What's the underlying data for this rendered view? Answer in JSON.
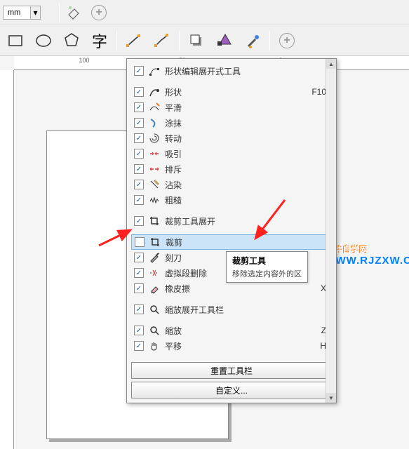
{
  "toolbar1": {
    "unit": "mm"
  },
  "ruler": {
    "labels": [
      "100",
      "50",
      "0"
    ]
  },
  "menu": {
    "groups": [
      {
        "items": [
          {
            "checked": true,
            "icon": "shape-edit",
            "label": "形状编辑展开式工具",
            "shortcut": ""
          }
        ]
      },
      {
        "items": [
          {
            "checked": true,
            "icon": "shape",
            "label": "形状",
            "shortcut": "F10"
          },
          {
            "checked": true,
            "icon": "smooth",
            "label": "平滑",
            "shortcut": ""
          },
          {
            "checked": true,
            "icon": "smear",
            "label": "涂抹",
            "shortcut": ""
          },
          {
            "checked": true,
            "icon": "twirl",
            "label": "转动",
            "shortcut": ""
          },
          {
            "checked": true,
            "icon": "attract",
            "label": "吸引",
            "shortcut": ""
          },
          {
            "checked": true,
            "icon": "repel",
            "label": "排斥",
            "shortcut": ""
          },
          {
            "checked": true,
            "icon": "stain",
            "label": "沾染",
            "shortcut": ""
          },
          {
            "checked": true,
            "icon": "roughen",
            "label": "粗糙",
            "shortcut": ""
          }
        ]
      },
      {
        "items": [
          {
            "checked": true,
            "icon": "crop-group",
            "label": "裁剪工具展开",
            "shortcut": ""
          }
        ]
      },
      {
        "items": [
          {
            "checked": false,
            "icon": "crop",
            "label": "裁剪",
            "shortcut": "",
            "highlighted": true
          },
          {
            "checked": true,
            "icon": "knife",
            "label": "刻刀",
            "shortcut": ""
          },
          {
            "checked": true,
            "icon": "vseg",
            "label": "虚拟段删除",
            "shortcut": ""
          },
          {
            "checked": true,
            "icon": "eraser",
            "label": "橡皮擦",
            "shortcut": "X"
          }
        ]
      },
      {
        "items": [
          {
            "checked": true,
            "icon": "zoom-group",
            "label": "缩放展开工具栏",
            "shortcut": ""
          }
        ]
      },
      {
        "items": [
          {
            "checked": true,
            "icon": "zoom",
            "label": "缩放",
            "shortcut": "Z"
          },
          {
            "checked": true,
            "icon": "pan",
            "label": "平移",
            "shortcut": "H"
          }
        ]
      }
    ],
    "reset_button": "重置工具栏",
    "custom_button": "自定义..."
  },
  "tooltip": {
    "title": "裁剪工具",
    "desc": "移除选定内容外的区"
  },
  "watermark": {
    "top": "软件自学网",
    "bottom": "WWW.RJZXW.COM"
  }
}
